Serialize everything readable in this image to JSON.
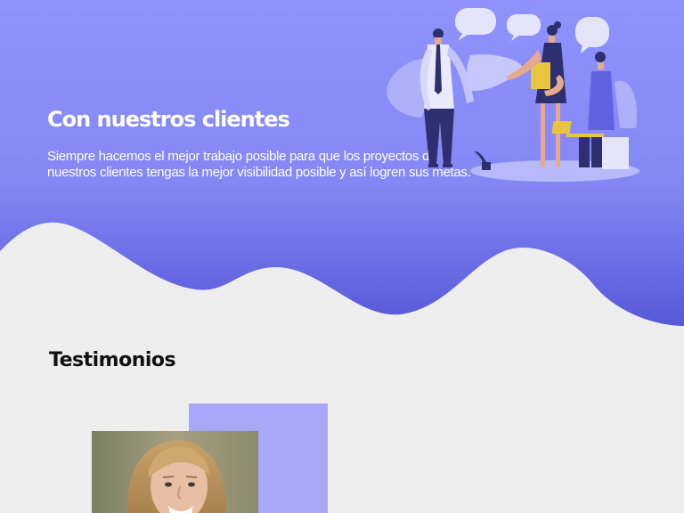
{
  "hero": {
    "title": "Con nuestros clientes",
    "description": "Siempre hacemos el mejor trabajo posible para que los proyectos de nuestros clientes tengas la mejor visibilidad posible y así logren sus metas.",
    "illustration_icon": "team-meeting-illustration"
  },
  "testimonials": {
    "title": "Testimonios",
    "photo_icon": "customer-portrait"
  },
  "colors": {
    "hero_top": "#8f92fb",
    "hero_bottom": "#5659d8",
    "page_bg": "#eeeeee",
    "accent": "#a7a9f8"
  }
}
